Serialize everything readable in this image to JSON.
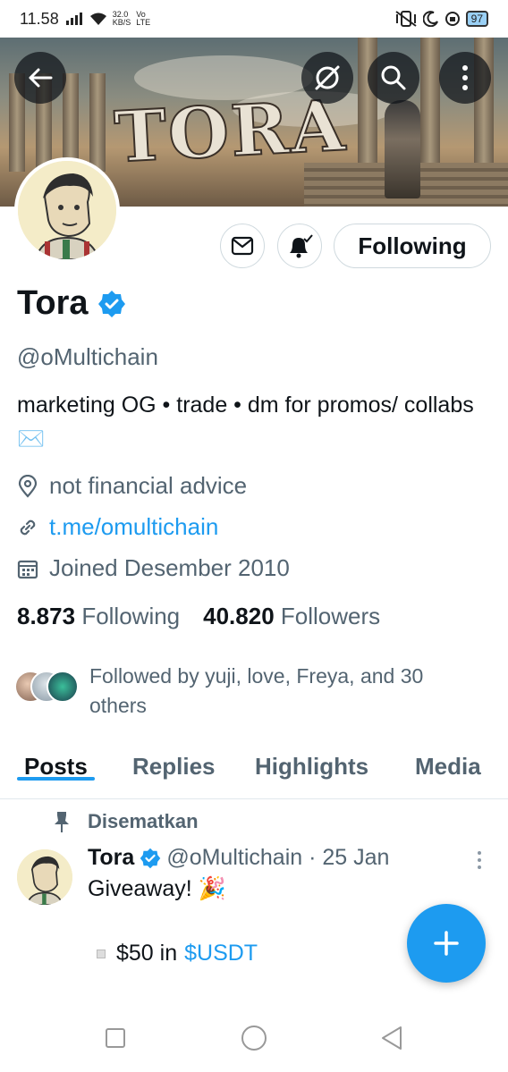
{
  "status_bar": {
    "time": "11.58",
    "net_speed": "32.0",
    "net_unit": "KB/S",
    "volte": "Vo",
    "network": "LTE",
    "battery": "97"
  },
  "profile": {
    "name": "Tora",
    "handle": "@oMultichain",
    "bio": "marketing OG • trade • dm for promos/ collabs ✉️",
    "location": "not financial advice",
    "link": "t.me/omultichain",
    "joined": "Joined Desember 2010",
    "following_count": "8.873",
    "following_label": "Following",
    "followers_count": "40.820",
    "followers_label": "Followers",
    "followed_by": "Followed by yuji, love, Freya, and 30 others",
    "follow_button": "Following",
    "banner_text": "TORA"
  },
  "tabs": [
    {
      "label": "Posts",
      "active": true
    },
    {
      "label": "Replies",
      "active": false
    },
    {
      "label": "Highlights",
      "active": false
    },
    {
      "label": "Media",
      "active": false
    }
  ],
  "post": {
    "pinned_label": "Disematkan",
    "author": "Tora",
    "handle_date": "@oMultichain · 25 Jan",
    "text": "Giveaway! 🎉",
    "line2_prefix": "$50 in",
    "line2_cashtag": "$USDT"
  },
  "colors": {
    "accent": "#1d9bf0",
    "text": "#0f1419",
    "muted": "#536471"
  }
}
